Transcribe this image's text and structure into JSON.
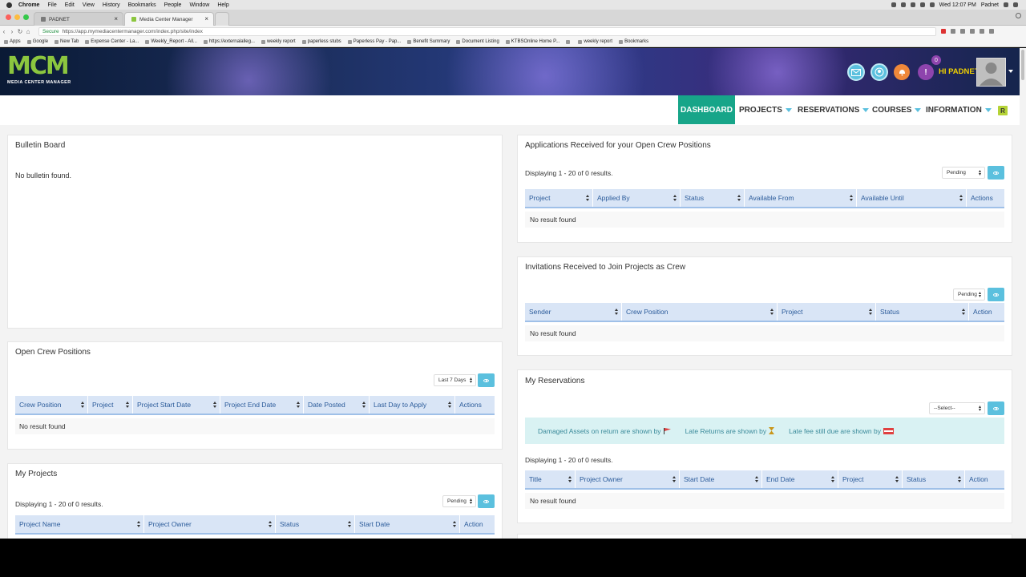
{
  "os_menubar": {
    "items": [
      "Chrome",
      "File",
      "Edit",
      "View",
      "History",
      "Bookmarks",
      "People",
      "Window",
      "Help"
    ],
    "clock": "Wed 12:07 PM",
    "user": "Padnet"
  },
  "browser": {
    "tabs": [
      {
        "label": "PADNET",
        "active": false
      },
      {
        "label": "Media Center Manager",
        "active": true
      }
    ],
    "secure_label": "Secure",
    "url": "https://app.mymediacentermanager.com/index.php/site/index",
    "bookmarks": [
      "Apps",
      "Google",
      "New Tab",
      "Expense Center - La...",
      "Weekly_Report - All...",
      "https://externalalleg...",
      "weekly report",
      "paperless stubs",
      "Paperless Pay - Pap...",
      "Benefit Summary",
      "Document Listing",
      "KTBSOnline Home P...",
      "",
      "weekly report",
      "Bookmarks"
    ]
  },
  "header": {
    "logo_text": "MCM",
    "logo_subtitle": "MEDIA CENTER MANAGER",
    "notification_count": "0",
    "greeting": "HI PADNET",
    "colors": {
      "mail": "#5bc0de",
      "user": "#5bc0de",
      "alert": "#f0883a",
      "info": "#8e44ad",
      "accent": "#17a589"
    }
  },
  "nav": {
    "dashboard": "DASHBOARD",
    "projects": "PROJECTS",
    "reservations": "RESERVATIONS",
    "courses": "COURSES",
    "information": "INFORMATION",
    "badge": "R"
  },
  "bulletin": {
    "title": "Bulletin Board",
    "empty": "No bulletin found."
  },
  "crew_positions": {
    "title": "Open Crew Positions",
    "filter": "Last 7 Days",
    "columns": [
      "Crew Position",
      "Project",
      "Project Start Date",
      "Project End Date",
      "Date Posted",
      "Last Day to Apply",
      "Actions"
    ],
    "empty": "No result found"
  },
  "my_projects": {
    "title": "My Projects",
    "filter": "Pending",
    "summary": "Displaying 1 - 20 of 0 results.",
    "columns": [
      "Project Name",
      "Project Owner",
      "Status",
      "Start Date",
      "Action"
    ]
  },
  "applications": {
    "title": "Applications Received for your Open Crew Positions",
    "summary": "Displaying 1 - 20 of 0 results.",
    "filter": "Pending",
    "columns": [
      "Project",
      "Applied By",
      "Status",
      "Available From",
      "Available Until",
      "Actions"
    ],
    "empty": "No result found"
  },
  "invitations": {
    "title": "Invitations Received to Join Projects as Crew",
    "filter": "Pending",
    "columns": [
      "Sender",
      "Crew Position",
      "Project",
      "Status",
      "Action"
    ],
    "empty": "No result found"
  },
  "reservations": {
    "title": "My Reservations",
    "filter": "--Select--",
    "legend": {
      "damaged": "Damaged Assets on return are shown by",
      "late": "Late Returns are shown by",
      "fee": "Late fee still due are shown by"
    },
    "summary": "Displaying 1 - 20 of 0 results.",
    "columns": [
      "Title",
      "Project Owner",
      "Start Date",
      "End Date",
      "Project",
      "Status",
      "Action"
    ],
    "empty": "No result found"
  }
}
